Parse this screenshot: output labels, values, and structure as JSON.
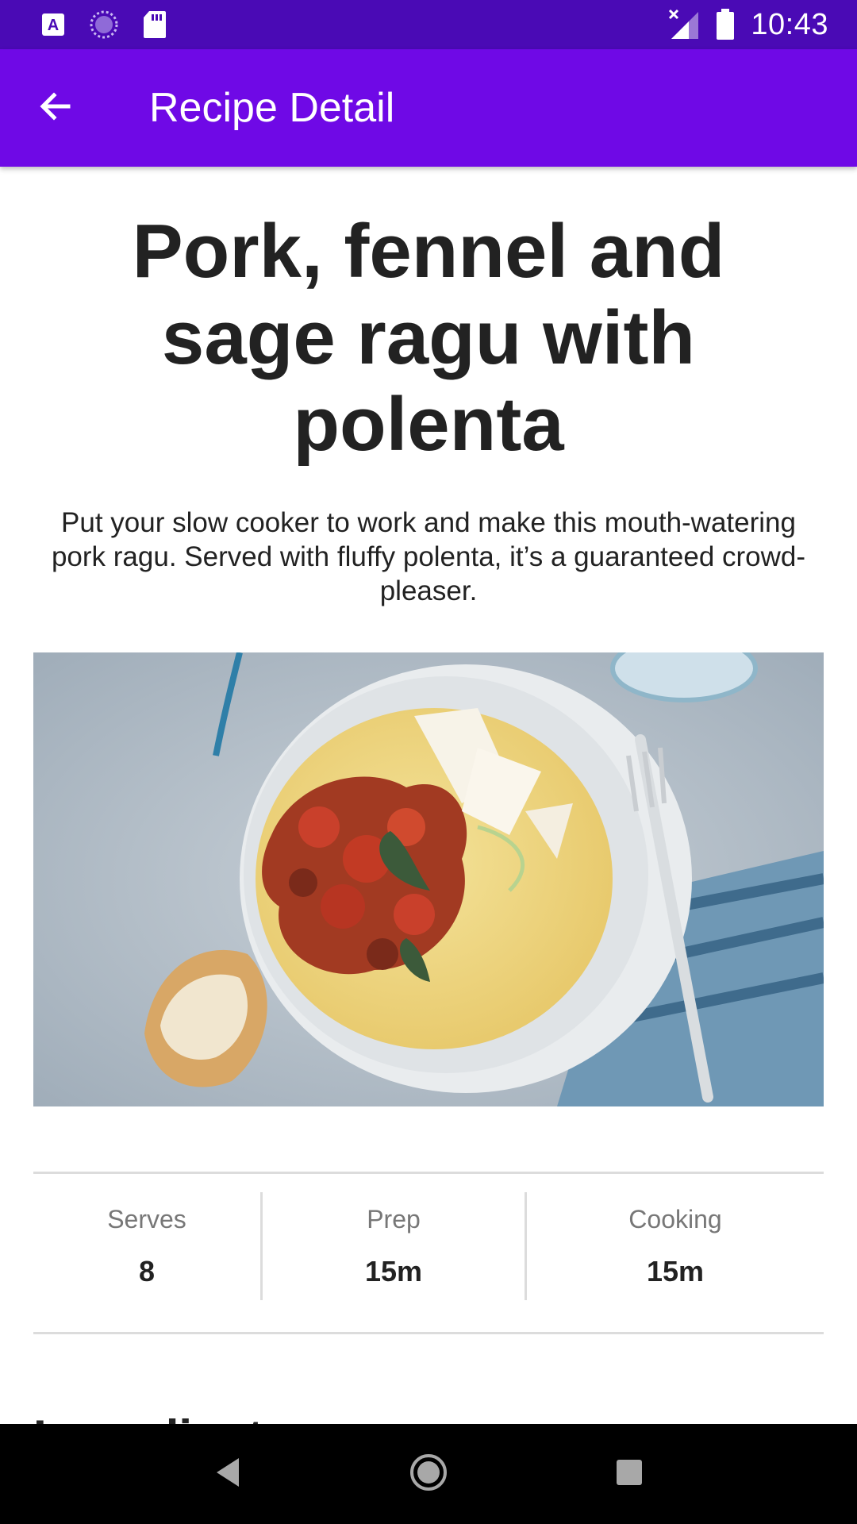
{
  "status_bar": {
    "time": "10:43",
    "left_icons": [
      "font-a-icon",
      "sync-icon",
      "sd-card-icon"
    ],
    "right_icons": [
      "signal-no-data-icon",
      "battery-icon"
    ]
  },
  "app_bar": {
    "title": "Recipe Detail",
    "back_icon": "arrow-left-icon",
    "background": "#6f09e6"
  },
  "recipe": {
    "title": "Pork, fennel and sage ragu with polenta",
    "description": "Put your slow cooker to work and make this mouth-watering pork ragu. Served with fluffy polenta, it’s a guaranteed crowd-pleaser."
  },
  "stats": [
    {
      "label": "Serves",
      "value": "8"
    },
    {
      "label": "Prep",
      "value": "15m"
    },
    {
      "label": "Cooking",
      "value": "15m"
    }
  ],
  "sections": {
    "ingredients_heading": "Ingredients"
  },
  "colors": {
    "status_bar": "#4a0ab5",
    "accent": "#6f09e6"
  },
  "nav_bar": {
    "icons": [
      "back-triangle-icon",
      "home-circle-icon",
      "recents-square-icon"
    ]
  }
}
